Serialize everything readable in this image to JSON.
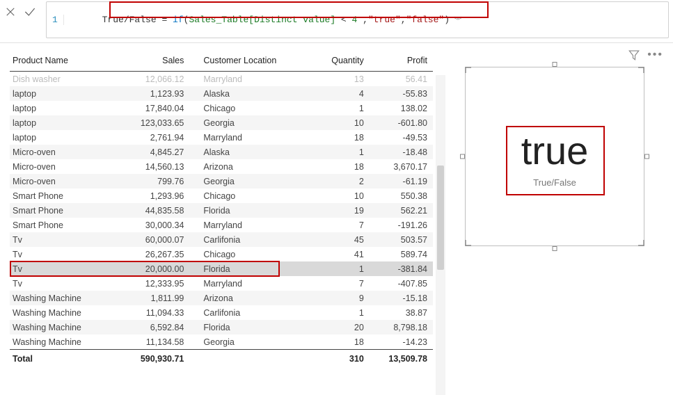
{
  "formula": {
    "line_number": "1",
    "measure_name": "True/False",
    "equals": " = ",
    "func": "if",
    "open_paren": "(",
    "table_ref": "Sales_Table",
    "col_ref": "[Distinct value]",
    "compare": " < ",
    "threshold": "4",
    "sep1": " ,",
    "true_str": "\"true\"",
    "sep2": ",",
    "false_str": "\"false\"",
    "close_paren": ")"
  },
  "table": {
    "columns": {
      "product": "Product Name",
      "sales": "Sales",
      "location": "Customer Location",
      "quantity": "Quantity",
      "profit": "Profit"
    },
    "rows": [
      {
        "product": "Dish washer",
        "sales": "12,066.12",
        "location": "Marryland",
        "quantity": "13",
        "profit": "56.41",
        "first": true
      },
      {
        "product": "laptop",
        "sales": "1,123.93",
        "location": "Alaska",
        "quantity": "4",
        "profit": "-55.83"
      },
      {
        "product": "laptop",
        "sales": "17,840.04",
        "location": "Chicago",
        "quantity": "1",
        "profit": "138.02"
      },
      {
        "product": "laptop",
        "sales": "123,033.65",
        "location": "Georgia",
        "quantity": "10",
        "profit": "-601.80"
      },
      {
        "product": "laptop",
        "sales": "2,761.94",
        "location": "Marryland",
        "quantity": "18",
        "profit": "-49.53"
      },
      {
        "product": "Micro-oven",
        "sales": "4,845.27",
        "location": "Alaska",
        "quantity": "1",
        "profit": "-18.48"
      },
      {
        "product": "Micro-oven",
        "sales": "14,560.13",
        "location": "Arizona",
        "quantity": "18",
        "profit": "3,670.17"
      },
      {
        "product": "Micro-oven",
        "sales": "799.76",
        "location": "Georgia",
        "quantity": "2",
        "profit": "-61.19"
      },
      {
        "product": "Smart Phone",
        "sales": "1,293.96",
        "location": "Chicago",
        "quantity": "10",
        "profit": "550.38"
      },
      {
        "product": "Smart Phone",
        "sales": "44,835.58",
        "location": "Florida",
        "quantity": "19",
        "profit": "562.21"
      },
      {
        "product": "Smart Phone",
        "sales": "30,000.34",
        "location": "Marryland",
        "quantity": "7",
        "profit": "-191.26"
      },
      {
        "product": "Tv",
        "sales": "60,000.07",
        "location": "Carlifonia",
        "quantity": "45",
        "profit": "503.57"
      },
      {
        "product": "Tv",
        "sales": "26,267.35",
        "location": "Chicago",
        "quantity": "41",
        "profit": "589.74"
      },
      {
        "product": "Tv",
        "sales": "20,000.00",
        "location": "Florida",
        "quantity": "1",
        "profit": "-381.84",
        "selected": true
      },
      {
        "product": "Tv",
        "sales": "12,333.95",
        "location": "Marryland",
        "quantity": "7",
        "profit": "-407.85"
      },
      {
        "product": "Washing Machine",
        "sales": "1,811.99",
        "location": "Arizona",
        "quantity": "9",
        "profit": "-15.18"
      },
      {
        "product": "Washing Machine",
        "sales": "11,094.33",
        "location": "Carlifonia",
        "quantity": "1",
        "profit": "38.87"
      },
      {
        "product": "Washing Machine",
        "sales": "6,592.84",
        "location": "Florida",
        "quantity": "20",
        "profit": "8,798.18"
      },
      {
        "product": "Washing Machine",
        "sales": "11,134.58",
        "location": "Georgia",
        "quantity": "18",
        "profit": "-14.23"
      }
    ],
    "total": {
      "label": "Total",
      "sales": "590,930.71",
      "quantity": "310",
      "profit": "13,509.78"
    }
  },
  "card": {
    "value": "true",
    "label": "True/False"
  }
}
